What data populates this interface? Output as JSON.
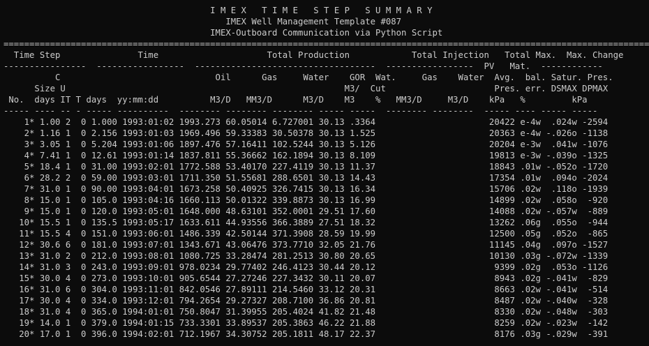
{
  "console": {
    "lines": [
      "                                        I M E X   T I M E   S T E P   S U M M A R Y",
      "                                           IMEX Well Management Template #087",
      "                                        IMEX-Outboard Communication via Python Script",
      "=============================================================================================================================",
      "  Time Step               Time                     Total Production            Total Injection   Total Max.  Max. Change",
      "----------------  -----------------  -----------------------------------  -----------------  PV   Mat.  ------------",
      "          C                              Oil      Gas     Water    GOR  Wat.     Gas    Water  Avg.  bal. Satur. Pres.",
      "      Size U                                                      M3/  Cut                     Pres. err. DSMAX DPMAX",
      " No.  days IT T days  yy:mm:dd          M3/D   MM3/D      M3/D    M3    %   MM3/D     M3/D    kPa   %         kPa",
      "----- ---- -- - ----- ----------  -------- -------- -------- ----- -----  -------- --------  ----- ---- ----- -----",
      "    1* 1.00 2  0 1.000 1993:01:02 1993.273 60.05014 6.727001 30.13 .3364                      20422 e-4w  .024w -2594",
      "    2* 1.16 1  0 2.156 1993:01:03 1969.496 59.33383 30.50378 30.13 1.525                      20363 e-4w -.026o -1138",
      "    3* 3.05 1  0 5.204 1993:01:06 1897.476 57.16411 102.5244 30.13 5.126                      20204 e-3w  .041w -1076",
      "    4* 7.41 1  0 12.61 1993:01:14 1837.811 55.36662 162.1894 30.13 8.109                      19813 e-3w -.039o -1325",
      "    5* 18.4 1  0 31.00 1993:02:01 1772.588 53.40170 227.4119 30.13 11.37                      18843 .01w -.052o -1720",
      "    6* 28.2 2  0 59.00 1993:03:01 1711.350 51.55681 288.6501 30.13 14.43                      17354 .01w  .094o -2024",
      "    7* 31.0 1  0 90.00 1993:04:01 1673.258 50.40925 326.7415 30.13 16.34                      15706 .02w  .118o -1939",
      "    8* 15.0 1  0 105.0 1993:04:16 1660.113 50.01322 339.8873 30.13 16.99                      14899 .02w  .058o  -920",
      "    9* 15.0 1  0 120.0 1993:05:01 1648.000 48.63101 352.0001 29.51 17.60                      14088 .02w -.057w  -889",
      "   10* 15.5 1  0 135.5 1993:05:17 1633.611 44.93556 366.3889 27.51 18.32                      13262 .06g  .055o  -944",
      "   11* 15.5 4  0 151.0 1993:06:01 1486.339 42.50144 371.3908 28.59 19.99                      12500 .05g  .052o  -865",
      "   12* 30.6 6  0 181.0 1993:07:01 1343.671 43.06476 373.7710 32.05 21.76                      11145 .04g  .097o -1527",
      "   13* 31.0 2  0 212.0 1993:08:01 1080.725 33.28474 281.2513 30.80 20.65                      10130 .03g -.072w -1339",
      "   14* 31.0 3  0 243.0 1993:09:01 978.0234 29.77402 246.4123 30.44 20.12                       9399 .02g  .053o -1126",
      "   15* 30.0 4  0 273.0 1993:10:01 905.6544 27.27246 227.3432 30.11 20.07                       8943 .02g -.041w  -829",
      "   16* 31.0 6  0 304.0 1993:11:01 842.0546 27.89111 214.5460 33.12 20.31                       8663 .02w -.041w  -514",
      "   17* 30.0 4  0 334.0 1993:12:01 794.2654 29.27327 208.7100 36.86 20.81                       8487 .02w -.040w  -328",
      "   18* 31.0 4  0 365.0 1994:01:01 750.8047 31.39955 205.4024 41.82 21.48                       8330 .02w -.048w  -303",
      "   19* 14.0 1  0 379.0 1994:01:15 733.3301 33.89537 205.3863 46.22 21.88                       8259 .02w -.023w  -142",
      "   20* 17.0 1  0 396.0 1994:02:01 712.1967 34.30752 205.1811 48.17 22.37                       8176 .03g -.029w  -391"
    ]
  }
}
